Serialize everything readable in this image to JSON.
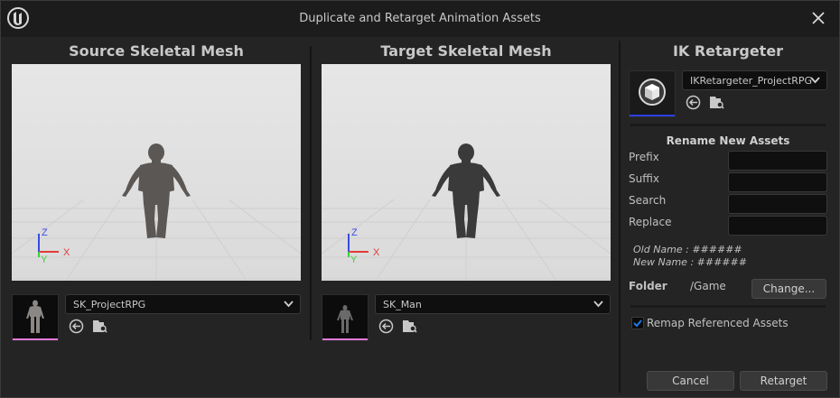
{
  "window": {
    "title": "Duplicate and Retarget Animation Assets"
  },
  "source": {
    "heading": "Source Skeletal Mesh",
    "mesh": "SK_ProjectRPG",
    "axes": {
      "z": "Z",
      "y": "Y",
      "x": "X"
    }
  },
  "target": {
    "heading": "Target Skeletal Mesh",
    "mesh": "SK_Man",
    "axes": {
      "z": "Z",
      "y": "Y",
      "x": "X"
    }
  },
  "retargeter": {
    "heading": "IK Retargeter",
    "asset": "IKRetargeter_ProjectRPG"
  },
  "rename": {
    "heading": "Rename New Assets",
    "prefix_label": "Prefix",
    "suffix_label": "Suffix",
    "search_label": "Search",
    "replace_label": "Replace",
    "prefix_value": "",
    "suffix_value": "",
    "search_value": "",
    "replace_value": "",
    "old_name": "Old Name : ######",
    "new_name": "New Name : ######"
  },
  "folder": {
    "label": "Folder",
    "path": "/Game",
    "change_label": "Change..."
  },
  "options": {
    "remap_label": "Remap Referenced Assets",
    "remap_checked": true
  },
  "actions": {
    "cancel_label": "Cancel",
    "retarget_label": "Retarget"
  },
  "colors": {
    "window_bg": "#242424",
    "titlebar_bg": "#1c1c1c",
    "viewport_bg": "#e2e2e2",
    "accent_blue": "#1e5ee8",
    "thumb_underline_pink": "#e079d8",
    "retargeter_underline_blue": "#2a3ee8",
    "axis_x": "#e23a3a",
    "axis_y": "#3ad03a",
    "axis_z": "#3a4ae2"
  }
}
